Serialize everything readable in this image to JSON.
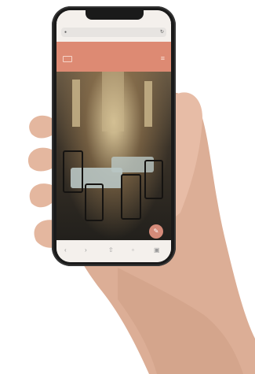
{
  "status_bar": {
    "time": "",
    "icons": ""
  },
  "browser": {
    "url": "",
    "url_lock_icon": "lock-icon",
    "reload_icon": "reload-icon",
    "toolbar_icons": [
      "back-arrow-icon",
      "forward-arrow-icon",
      "share-icon",
      "bookmarks-icon",
      "tabs-icon"
    ]
  },
  "site": {
    "header_color": "#dd8a73",
    "nav_text": "",
    "hero_title": "",
    "fab_icon": "edit-icon"
  },
  "scene": {
    "hand_skin": "#e2b49c"
  }
}
